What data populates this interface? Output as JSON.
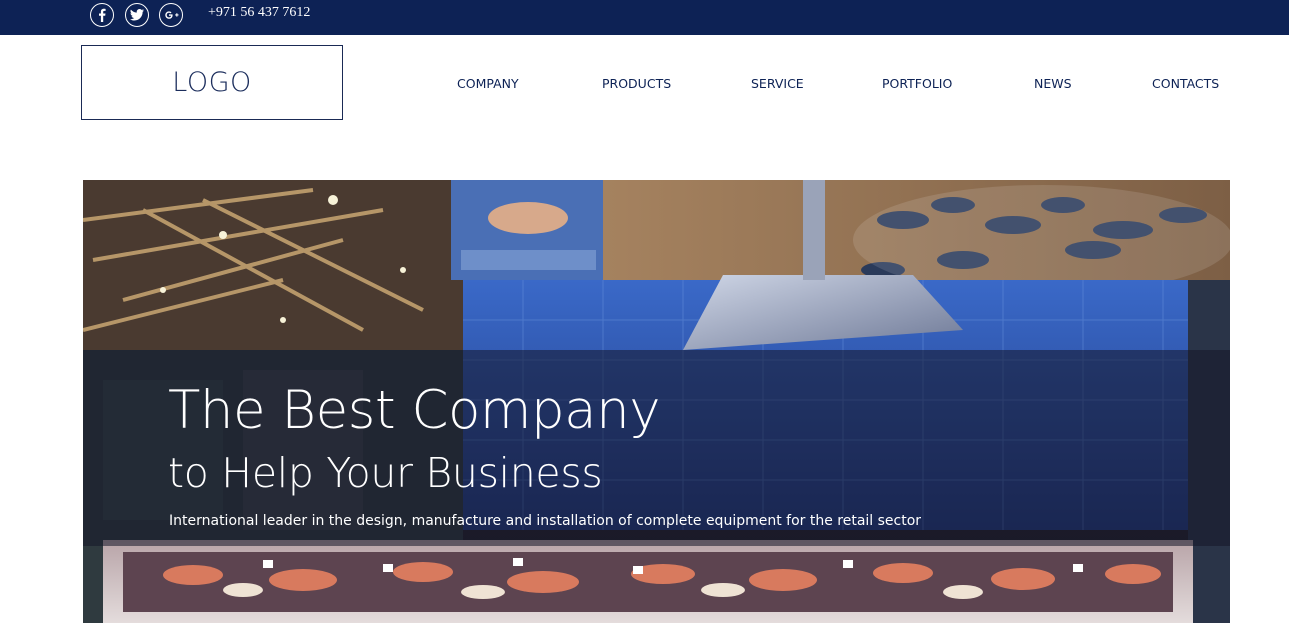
{
  "topbar": {
    "social": [
      {
        "name": "facebook-icon",
        "glyph": "f"
      },
      {
        "name": "twitter-icon",
        "glyph": "t"
      },
      {
        "name": "google-plus-icon",
        "glyph": "G+"
      }
    ],
    "phone": "+971 56 437 7612"
  },
  "header": {
    "logo": "LOGO",
    "nav": {
      "company": "COMPANY",
      "products": "PRODUCTS",
      "service": "SERVICE",
      "portfolio": "PORTFOLIO",
      "news": "NEWS",
      "contacts": "CONTACTS"
    }
  },
  "hero": {
    "title": "The Best Company",
    "subtitle": "to Help Your Business",
    "description": "International leader in the design, manufacture and installation of complete equipment for the retail sector"
  },
  "colors": {
    "topbar": "#0d2255",
    "nav_text": "#0d2255",
    "hero_overlay": "#14162880"
  }
}
